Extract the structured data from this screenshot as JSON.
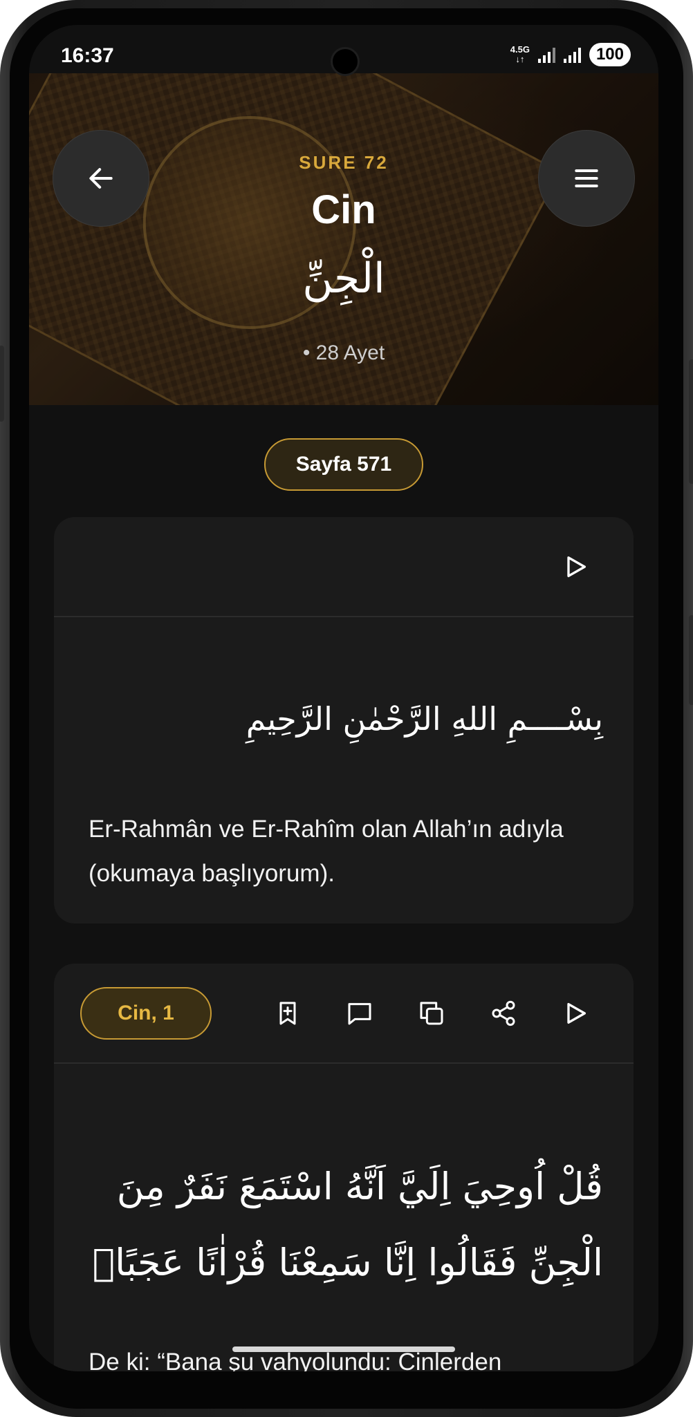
{
  "status_bar": {
    "time": "16:37",
    "network": "4.5G",
    "battery": "100"
  },
  "header": {
    "sure_label": "SURE 72",
    "sure_name": "Cin",
    "sure_arabic": "الْجِنِّ",
    "ayet_count": "• 28 Ayet"
  },
  "page_label": "Sayfa 571",
  "basmala_card": {
    "arabic": "بِسْــــمِ اللهِ الرَّحْمٰنِ الرَّحِيمِ",
    "translation": "Er-Rahmân ve Er-Rahîm olan Allah’ın adıyla (okumaya başlıyorum)."
  },
  "ayah_card": {
    "label": "Cin, 1",
    "arabic": "قُلْ اُوحِيَ اِلَيَّ اَنَّهُ اسْتَمَعَ نَفَرٌ مِنَ الْجِنِّ فَقَالُوا اِنَّا سَمِعْنَا قُرْاٰنًا عَجَبًاۙ",
    "translation": "De ki: “Bana şu vahyolundu: Cinlerden"
  },
  "colors": {
    "accent_gold": "#d9a93c",
    "card_bg": "#1b1b1b",
    "screen_bg": "#111111"
  },
  "icons": {
    "back": "arrow-left-icon",
    "menu": "hamburger-menu-icon",
    "play": "play-icon",
    "bookmark": "bookmark-add-icon",
    "comment": "comment-icon",
    "copy": "copy-icon",
    "share": "share-icon"
  }
}
